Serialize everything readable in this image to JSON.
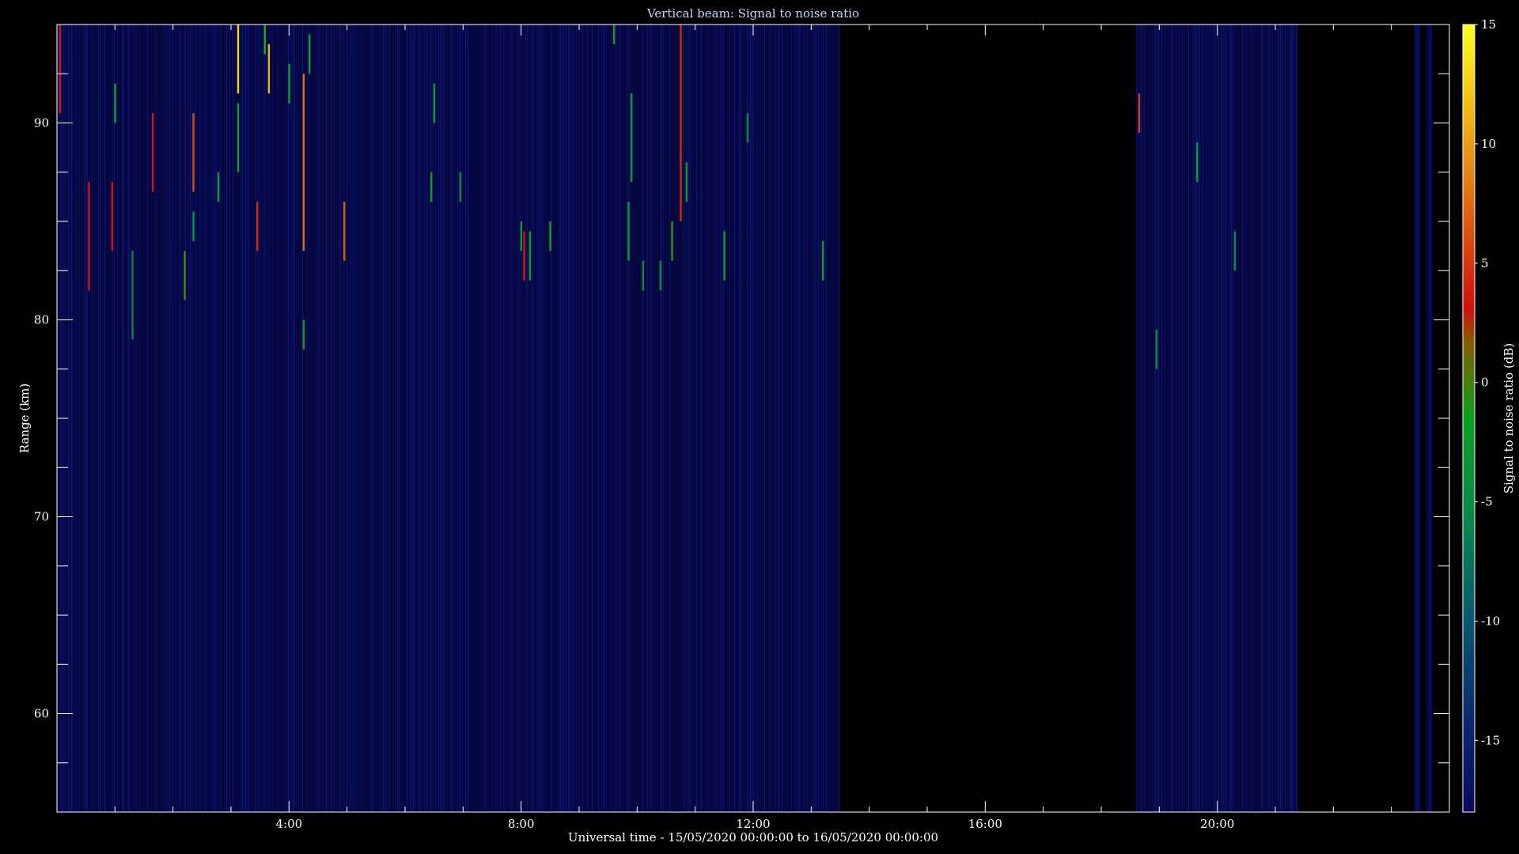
{
  "chart_data": {
    "type": "heatmap",
    "title": "Vertical beam: Signal to noise ratio",
    "xlabel": "Universal time - 15/05/2020 00:00:00 to 16/05/2020 00:00:00",
    "ylabel": "Range (km)",
    "colorbar_label": "Signal to noise ratio (dB)",
    "x_unit": "hours UT",
    "xlim": [
      0,
      24
    ],
    "ylim": [
      55,
      95
    ],
    "clim": [
      -18,
      15
    ],
    "x_ticks": [
      {
        "value": 4,
        "label": "4:00"
      },
      {
        "value": 8,
        "label": "8:00"
      },
      {
        "value": 12,
        "label": "12:00"
      },
      {
        "value": 16,
        "label": "16:00"
      },
      {
        "value": 20,
        "label": "20:00"
      }
    ],
    "y_ticks": [
      {
        "value": 60,
        "label": "60"
      },
      {
        "value": 70,
        "label": "70"
      },
      {
        "value": 80,
        "label": "80"
      },
      {
        "value": 90,
        "label": "90"
      }
    ],
    "c_ticks": [
      {
        "value": 15,
        "label": "15"
      },
      {
        "value": 10,
        "label": "10"
      },
      {
        "value": 5,
        "label": "5"
      },
      {
        "value": 0,
        "label": "0"
      },
      {
        "value": -5,
        "label": "-5"
      },
      {
        "value": -10,
        "label": "-10"
      },
      {
        "value": -15,
        "label": "-15"
      }
    ],
    "data_coverage": [
      [
        0,
        13.5
      ],
      [
        18.6,
        21.4
      ],
      [
        23.4,
        23.5
      ],
      [
        23.6,
        23.7
      ]
    ],
    "background_snr": -17,
    "echoes": [
      {
        "t": 0.05,
        "r0": 90.5,
        "r1": 95.0,
        "snr": 0
      },
      {
        "t": 0.55,
        "r0": 81.5,
        "r1": 87.0,
        "snr": 0
      },
      {
        "t": 0.95,
        "r0": 83.5,
        "r1": 87.0,
        "snr": 0
      },
      {
        "t": 1.0,
        "r0": 90.0,
        "r1": 92.0,
        "snr": -5
      },
      {
        "t": 1.3,
        "r0": 79.0,
        "r1": 83.5,
        "snr": -7
      },
      {
        "t": 1.65,
        "r0": 86.5,
        "r1": 90.5,
        "snr": 0
      },
      {
        "t": 2.2,
        "r0": 81.0,
        "r1": 83.5,
        "snr": -3
      },
      {
        "t": 2.35,
        "r0": 86.5,
        "r1": 90.5,
        "snr": 3
      },
      {
        "t": 2.35,
        "r0": 84.0,
        "r1": 85.5,
        "snr": -5
      },
      {
        "t": 2.78,
        "r0": 86.0,
        "r1": 87.5,
        "snr": -5
      },
      {
        "t": 3.12,
        "r0": 91.5,
        "r1": 95.0,
        "snr": 12
      },
      {
        "t": 3.12,
        "r0": 87.5,
        "r1": 91.0,
        "snr": -5
      },
      {
        "t": 3.45,
        "r0": 83.5,
        "r1": 86.0,
        "snr": 1
      },
      {
        "t": 3.58,
        "r0": 93.5,
        "r1": 95.0,
        "snr": -4
      },
      {
        "t": 3.65,
        "r0": 91.5,
        "r1": 94.0,
        "snr": 10
      },
      {
        "t": 4.0,
        "r0": 91.0,
        "r1": 93.0,
        "snr": -5
      },
      {
        "t": 4.25,
        "r0": 83.5,
        "r1": 92.5,
        "snr": 5
      },
      {
        "t": 4.25,
        "r0": 78.5,
        "r1": 80.0,
        "snr": -5
      },
      {
        "t": 4.35,
        "r0": 92.5,
        "r1": 94.5,
        "snr": -5
      },
      {
        "t": 4.95,
        "r0": 83.0,
        "r1": 86.0,
        "snr": 4
      },
      {
        "t": 6.45,
        "r0": 86.0,
        "r1": 87.5,
        "snr": -5
      },
      {
        "t": 6.5,
        "r0": 90.0,
        "r1": 92.0,
        "snr": -5
      },
      {
        "t": 6.95,
        "r0": 86.0,
        "r1": 87.5,
        "snr": -6
      },
      {
        "t": 8.0,
        "r0": 83.5,
        "r1": 85.0,
        "snr": -5
      },
      {
        "t": 8.05,
        "r0": 82.0,
        "r1": 84.5,
        "snr": 0
      },
      {
        "t": 8.15,
        "r0": 82.0,
        "r1": 84.5,
        "snr": -5
      },
      {
        "t": 8.5,
        "r0": 83.5,
        "r1": 85.0,
        "snr": -5
      },
      {
        "t": 9.6,
        "r0": 94.0,
        "r1": 95.0,
        "snr": -5
      },
      {
        "t": 9.85,
        "r0": 83.0,
        "r1": 86.0,
        "snr": -5
      },
      {
        "t": 9.9,
        "r0": 87.0,
        "r1": 91.5,
        "snr": -5
      },
      {
        "t": 10.1,
        "r0": 81.5,
        "r1": 83.0,
        "snr": -6
      },
      {
        "t": 10.4,
        "r0": 81.5,
        "r1": 83.0,
        "snr": -6
      },
      {
        "t": 10.6,
        "r0": 83.0,
        "r1": 85.0,
        "snr": -3
      },
      {
        "t": 10.75,
        "r0": 85.0,
        "r1": 95.0,
        "snr": 1
      },
      {
        "t": 10.85,
        "r0": 86.0,
        "r1": 88.0,
        "snr": -5
      },
      {
        "t": 11.5,
        "r0": 82.0,
        "r1": 84.5,
        "snr": -5
      },
      {
        "t": 11.9,
        "r0": 89.0,
        "r1": 90.5,
        "snr": -6
      },
      {
        "t": 13.2,
        "r0": 82.0,
        "r1": 84.0,
        "snr": -5
      },
      {
        "t": 18.65,
        "r0": 89.5,
        "r1": 91.5,
        "snr": 2
      },
      {
        "t": 18.95,
        "r0": 77.5,
        "r1": 79.5,
        "snr": -6
      },
      {
        "t": 19.65,
        "r0": 87.0,
        "r1": 89.0,
        "snr": -5
      },
      {
        "t": 20.3,
        "r0": 82.5,
        "r1": 84.5,
        "snr": -6
      }
    ]
  }
}
